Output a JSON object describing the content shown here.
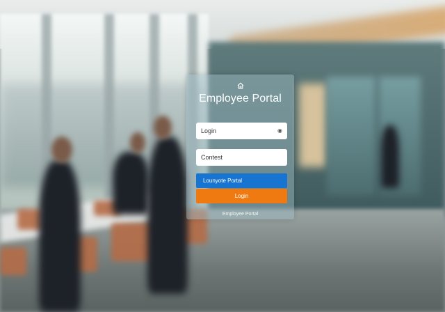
{
  "panel": {
    "logo_icon": "home-icon",
    "title": "Employee Portal",
    "login_field": {
      "value": "Login",
      "icon": "eye-icon"
    },
    "password_field": {
      "value": "Contest"
    },
    "primary_button_label": "Lounyote Portal",
    "login_button_label": "Login",
    "footer_link": "Employee Portal"
  },
  "colors": {
    "primary_button": "#1774d0",
    "login_button": "#f07a12"
  }
}
